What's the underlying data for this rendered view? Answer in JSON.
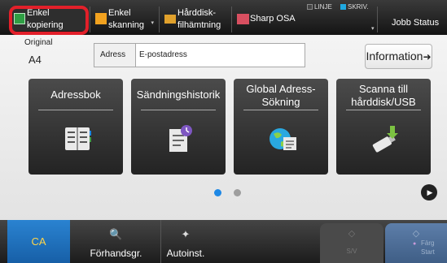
{
  "tabs": {
    "copy": {
      "label_l1": "Enkel",
      "label_l2": "kopiering"
    },
    "scan": {
      "label_l1": "Enkel",
      "label_l2": "skanning"
    },
    "hdd": {
      "label_l1": "Hårddisk-",
      "label_l2": "filhämtning"
    },
    "osa": {
      "label": "Sharp OSA"
    },
    "job_status": {
      "label": "Jobb Status"
    }
  },
  "status": {
    "line": "LINJE",
    "print": "SKRIV."
  },
  "original": {
    "label": "Original",
    "value": "A4"
  },
  "address": {
    "label": "Adress",
    "value": "E-postadress"
  },
  "info_button": {
    "label": "Information"
  },
  "tiles": [
    {
      "label": "Adressbok"
    },
    {
      "label": "Sändningshistorik"
    },
    {
      "label_l1": "Global Adress-",
      "label_l2": "Sökning"
    },
    {
      "label_l1": "Scanna till",
      "label_l2": "hårddisk/USB"
    }
  ],
  "pager": {
    "pages": 2,
    "current": 1
  },
  "bottom": {
    "ca": "CA",
    "preview": "Förhandsgr.",
    "autoset": "Autoinst.",
    "sw": "S/V",
    "color_l1": "Färg",
    "color_l2": "Start"
  },
  "colors": {
    "highlight": "#e2202a",
    "ca_button": "#1f6fbf",
    "ca_text": "#ffd54a",
    "copy_icon": "#2f9f44",
    "scan_icon": "#f2a21f",
    "pager_active": "#1e88e5",
    "pager_inactive": "#9e9e9e"
  }
}
